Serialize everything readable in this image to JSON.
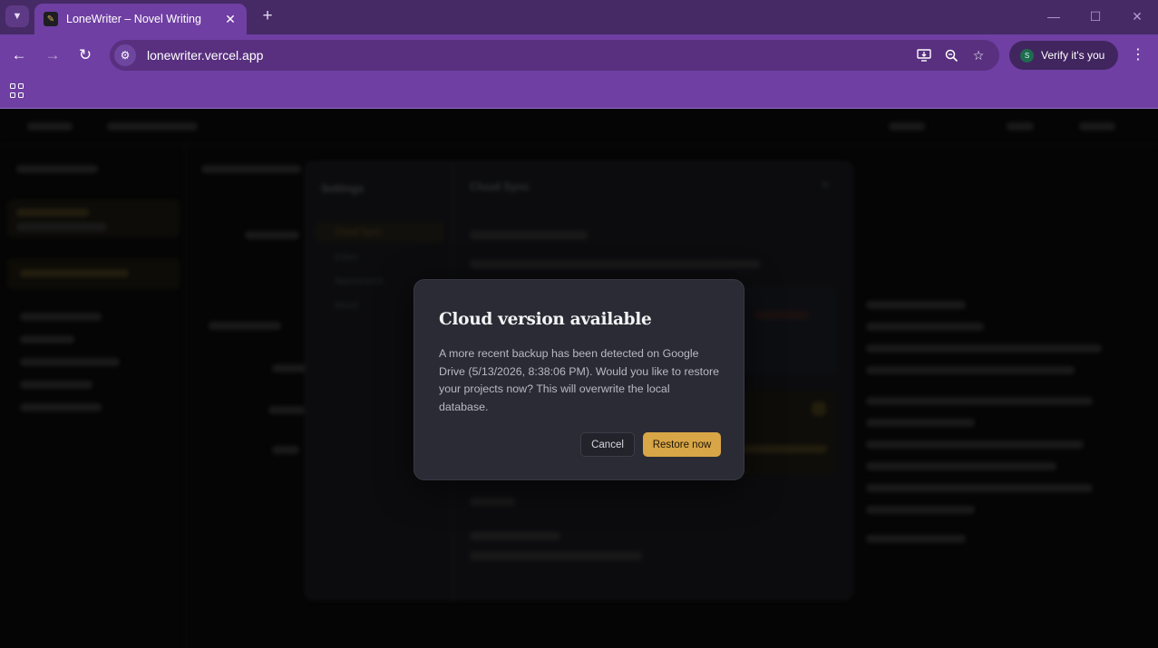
{
  "browser": {
    "tab_title": "LoneWriter – Novel Writing",
    "url": "lonewriter.vercel.app",
    "profile_initial": "S",
    "verify_label": "Verify it's you"
  },
  "app": {
    "settings": {
      "title": "Settings",
      "menu": [
        "Cloud Sync",
        "Editor",
        "Appearance",
        "About"
      ],
      "section_title": "Cloud Sync"
    }
  },
  "dialog": {
    "title": "Cloud version available",
    "body": "A more recent backup has been detected on Google Drive (5/13/2026, 8:38:06 PM). Would you like to restore your projects now? This will overwrite the local database.",
    "cancel_label": "Cancel",
    "restore_label": "Restore now"
  },
  "colors": {
    "chrome_accent": "#6f3fa3",
    "dialog_bg": "#2a2b34",
    "primary_button": "#d9a647"
  }
}
